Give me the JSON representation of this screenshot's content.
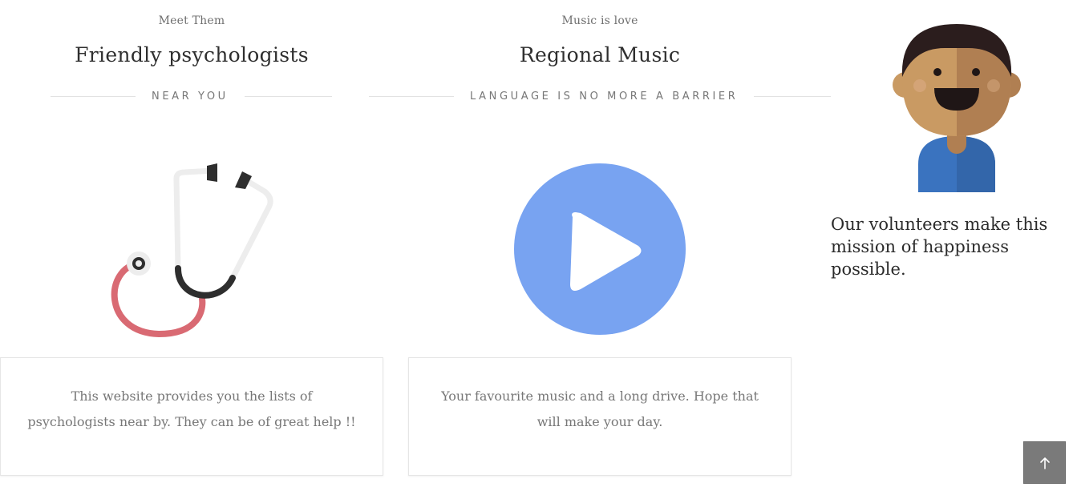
{
  "psychologists": {
    "eyebrow": "Meet Them",
    "title": "Friendly psychologists",
    "subtitle": "NEAR YOU",
    "description": "This website provides you the lists of psychologists near by. They can be of great help !!",
    "icon": "stethoscope-icon"
  },
  "music": {
    "eyebrow": "Music is love",
    "title": "Regional Music",
    "subtitle": "LANGUAGE IS NO MORE A BARRIER",
    "description": "Your favourite music and a long drive. Hope that will make your day.",
    "icon": "play-icon"
  },
  "volunteers": {
    "text": "Our volunteers make this mission of happiness possible.",
    "icon": "volunteer-avatar-icon"
  },
  "back_to_top": {
    "icon": "arrow-up-icon"
  },
  "colors": {
    "play_circle": "#78A3F1",
    "stethoscope_tube": "#D96A73",
    "stethoscope_dark": "#2E2E2E",
    "stethoscope_light": "#EDEDED",
    "skin_light": "#C99A63",
    "skin_dark": "#B07F52",
    "hair": "#2B1D1D",
    "shirt": "#3A73BF",
    "back_to_top_bg": "#7A7A7A"
  }
}
